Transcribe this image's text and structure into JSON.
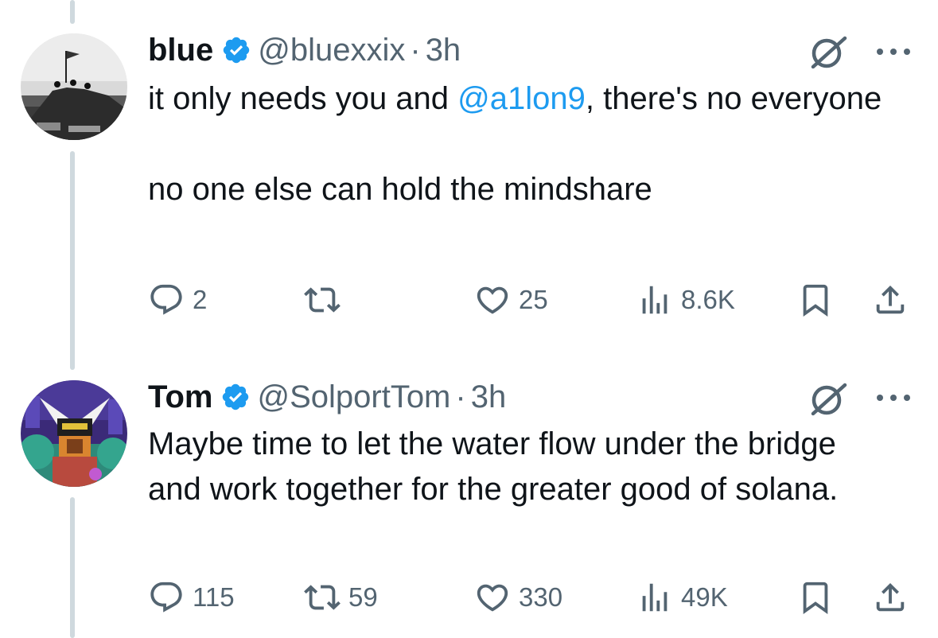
{
  "tweets": [
    {
      "name": "blue",
      "handle": "@bluexxix",
      "separator": "·",
      "time": "3h",
      "text_before_mention": "it only needs you and ",
      "mention": "@a1lon9",
      "text_after_mention": ", there's no everyone",
      "paragraph_2": "no one else can hold the mindshare",
      "replies": "2",
      "retweets": "",
      "likes": "25",
      "views": "8.6K"
    },
    {
      "name": "Tom",
      "handle": "@SolportTom",
      "separator": "·",
      "time": "3h",
      "text": "Maybe time to let the water flow under the bridge and work together for the greater good of solana.",
      "replies": "115",
      "retweets": "59",
      "likes": "330",
      "views": "49K"
    }
  ],
  "colors": {
    "accent": "#1d9bf0",
    "secondary_text": "#536471",
    "primary_text": "#0f1419",
    "thread_line": "#cfd9de"
  },
  "icons": [
    "verified-badge-icon",
    "grok-icon",
    "more-icon",
    "reply-icon",
    "retweet-icon",
    "like-icon",
    "views-icon",
    "bookmark-icon",
    "share-icon"
  ]
}
